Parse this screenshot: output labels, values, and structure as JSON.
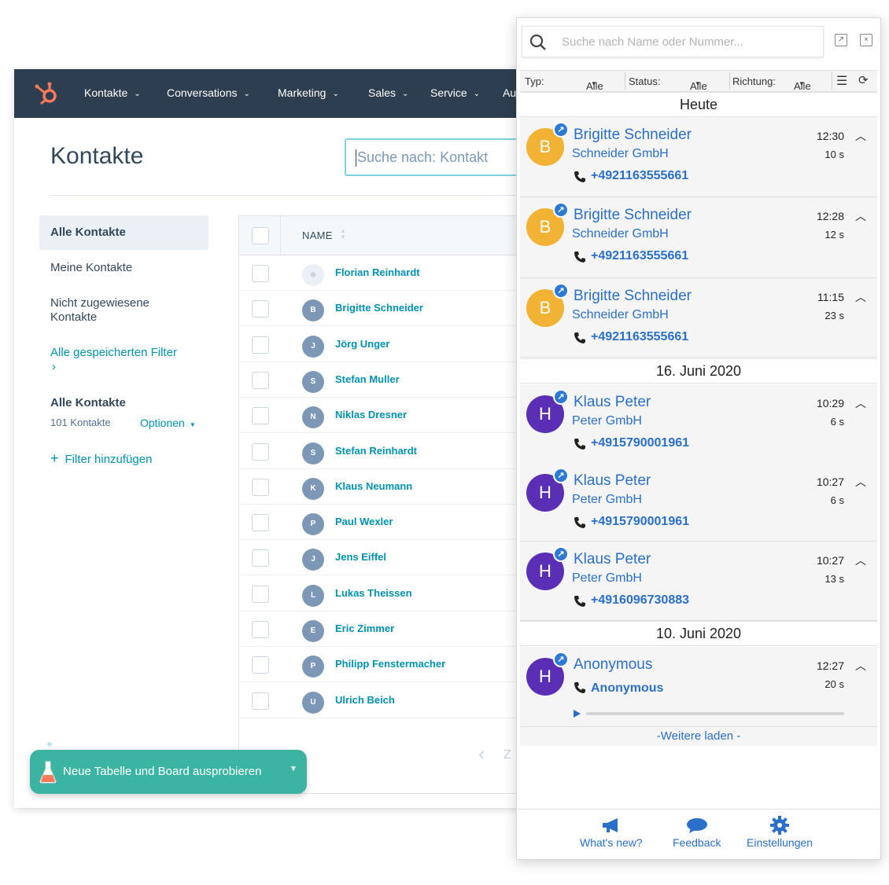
{
  "crm": {
    "nav": [
      {
        "label": "Kontakte"
      },
      {
        "label": "Conversations"
      },
      {
        "label": "Marketing"
      },
      {
        "label": "Sales"
      },
      {
        "label": "Service"
      },
      {
        "label": "Au"
      }
    ],
    "title": "Kontakte",
    "search_placeholder": "Suche nach: Kontakt",
    "sidebar": {
      "active": "Alle Kontakte",
      "mine": "Meine Kontakte",
      "unassigned": "Nicht zugewiesene Kontakte",
      "saved_filters": "Alle gespeicherten Filter",
      "saved_filters_arrow": "›",
      "view_title": "Alle Kontakte",
      "count": "101 Kontakte",
      "options": "Optionen",
      "add_filter": "Filter hinzufügen"
    },
    "table": {
      "column_name": "NAME",
      "rows": [
        {
          "initial": "",
          "name": "Florian Reinhardt"
        },
        {
          "initial": "B",
          "name": "Brigitte Schneider"
        },
        {
          "initial": "J",
          "name": "Jörg Unger"
        },
        {
          "initial": "S",
          "name": "Stefan Muller"
        },
        {
          "initial": "N",
          "name": "Niklas Dresner"
        },
        {
          "initial": "S",
          "name": "Stefan Reinhardt"
        },
        {
          "initial": "K",
          "name": "Klaus Neumann"
        },
        {
          "initial": "P",
          "name": "Paul Wexler"
        },
        {
          "initial": "J",
          "name": "Jens Eiffel"
        },
        {
          "initial": "L",
          "name": "Lukas Theissen"
        },
        {
          "initial": "E",
          "name": "Eric Zimmer"
        },
        {
          "initial": "P",
          "name": "Philipp Fenstermacher"
        },
        {
          "initial": "U",
          "name": "Ulrich Beich"
        }
      ]
    },
    "pager_next": "Z",
    "banner": "Neue Tabelle und Board ausprobieren"
  },
  "panel": {
    "search_placeholder": "Suche nach Name oder Nummer...",
    "filters": {
      "type_label": "Typ:",
      "type_value": "Alle",
      "status_label": "Status:",
      "status_value": "Alle",
      "direction_label": "Richtung:",
      "direction_value": "Alle"
    },
    "groups": [
      {
        "date": "Heute"
      },
      {
        "date": "16. Juni 2020"
      },
      {
        "date": "10. Juni 2020"
      }
    ],
    "calls": [
      {
        "initial": "B",
        "color": "#f2b233",
        "name": "Brigitte Schneider",
        "company": "Schneider GmbH",
        "phone": "+4921163555661",
        "time": "12:30",
        "duration": "10 s"
      },
      {
        "initial": "B",
        "color": "#f2b233",
        "name": "Brigitte Schneider",
        "company": "Schneider GmbH",
        "phone": "+4921163555661",
        "time": "12:28",
        "duration": "12 s"
      },
      {
        "initial": "B",
        "color": "#f2b233",
        "name": "Brigitte Schneider",
        "company": "Schneider GmbH",
        "phone": "+4921163555661",
        "time": "11:15",
        "duration": "23 s"
      },
      {
        "initial": "H",
        "color": "#5b2fb5",
        "name": "Klaus Peter",
        "company": "Peter GmbH",
        "phone": "+4915790001961",
        "time": "10:29",
        "duration": "6 s"
      },
      {
        "initial": "H",
        "color": "#5b2fb5",
        "name": "Klaus Peter",
        "company": "Peter GmbH",
        "phone": "+4915790001961",
        "time": "10:27",
        "duration": "6 s"
      },
      {
        "initial": "H",
        "color": "#5b2fb5",
        "name": "Klaus Peter",
        "company": "Peter GmbH",
        "phone": "+4916096730883",
        "time": "10:27",
        "duration": "13 s"
      },
      {
        "initial": "H",
        "color": "#5b2fb5",
        "name": "Anonymous",
        "company": "",
        "phone": "Anonymous",
        "time": "12:27",
        "duration": "20 s"
      }
    ],
    "load_more": "-Weitere laden -",
    "footer": {
      "whats_new": "What's new?",
      "feedback": "Feedback",
      "settings": "Einstellungen"
    }
  }
}
